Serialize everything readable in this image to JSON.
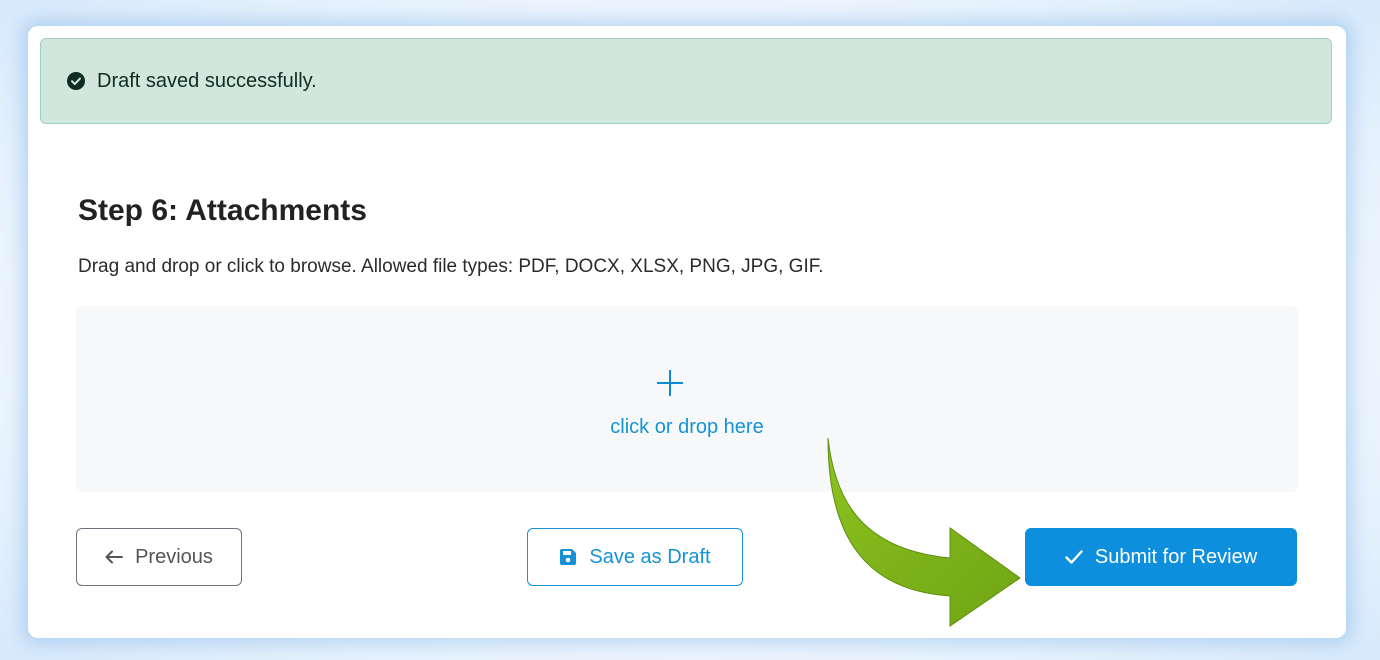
{
  "alert": {
    "message": "Draft saved successfully.",
    "icon": "check-circle-icon",
    "color": "#d1e7dd"
  },
  "step": {
    "title": "Step 6: Attachments",
    "description": "Drag and drop or click to browse. Allowed file types: PDF, DOCX, XLSX, PNG, JPG, GIF."
  },
  "dropzone": {
    "icon": "plus-icon",
    "label": "click or drop here"
  },
  "buttons": {
    "previous": {
      "label": "Previous",
      "icon": "arrow-left-icon"
    },
    "save_draft": {
      "label": "Save as Draft",
      "icon": "floppy-disk-icon"
    },
    "submit": {
      "label": "Submit for Review",
      "icon": "checkmark-icon"
    }
  },
  "colors": {
    "primary": "#0d8fde",
    "success_bg": "#d1e7dd",
    "annotation_arrow": "#7ab21c"
  }
}
